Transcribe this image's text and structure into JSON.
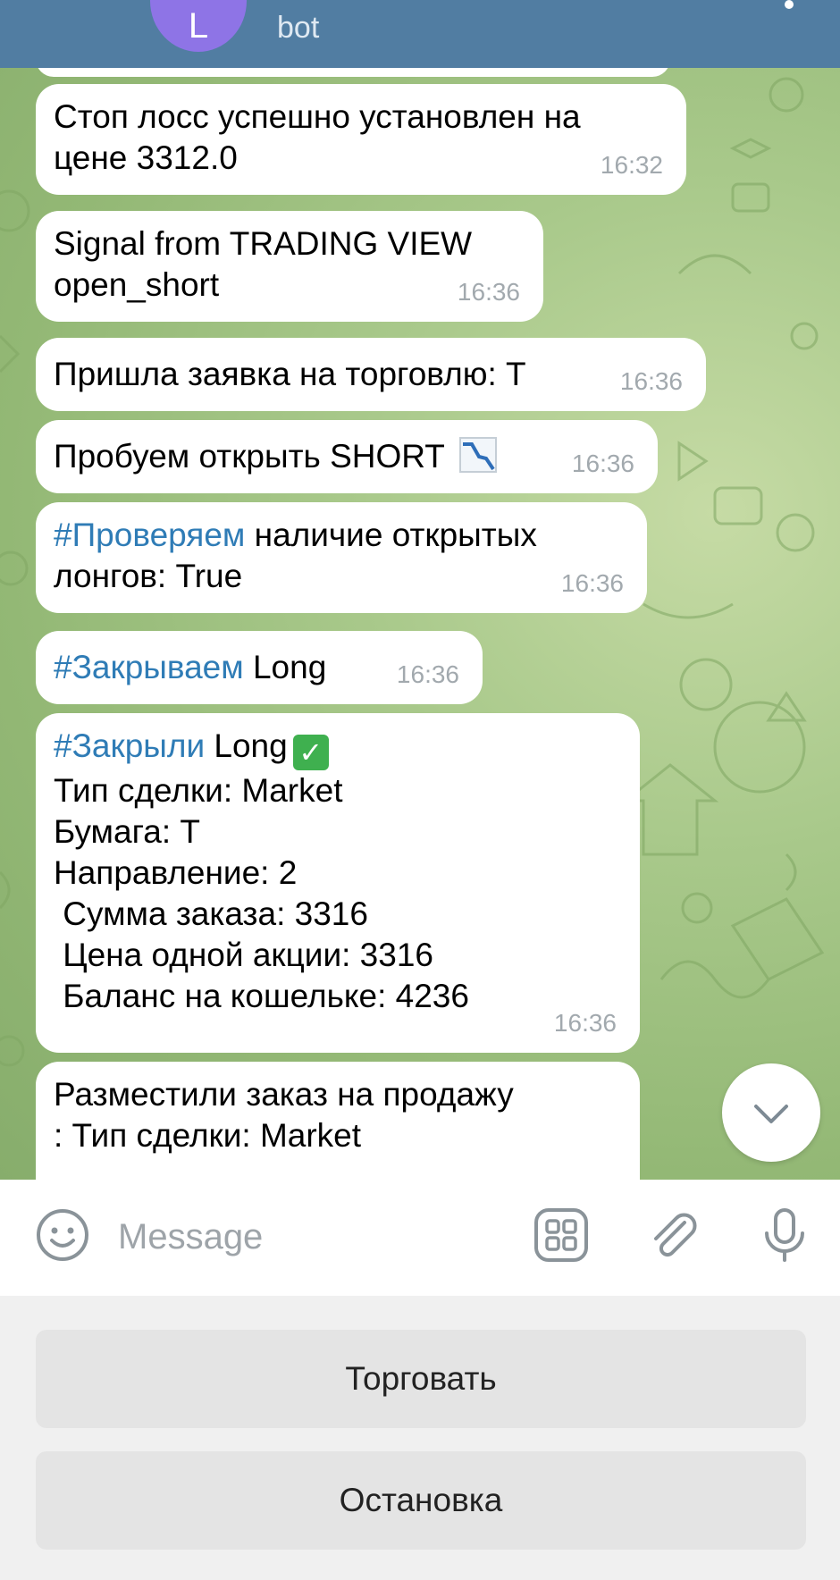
{
  "header": {
    "avatar_letter": "L",
    "subtitle": "bot"
  },
  "messages": [
    {
      "lines": [
        "Стоп лосс успешно установлен на",
        "цене 3312.0"
      ],
      "time": "16:32"
    },
    {
      "lines": [
        "Signal from TRADING VIEW",
        "open_short"
      ],
      "time": "16:36"
    },
    {
      "text": "Пришла заявка на торговлю: T",
      "time": "16:36"
    },
    {
      "text": "Пробуем открыть SHORT",
      "emoji": "chart-decreasing-icon",
      "time": "16:36"
    },
    {
      "hashtag": "#Проверяем",
      "rest": " наличие открытых",
      "line2": "лонгов: True",
      "time": "16:36"
    },
    {
      "hashtag": "#Закрываем",
      "rest": " Long",
      "time": "16:36"
    },
    {
      "hashtag": "#Закрыли",
      "rest": " Long",
      "emoji": "check-mark-icon",
      "lines": [
        "Тип сделки: Market",
        "Бумага: T",
        "Направление: 2",
        " Сумма заказа: 3316",
        " Цена одной акции: 3316",
        " Баланс на кошельке: 4236"
      ],
      "time": "16:36"
    },
    {
      "lines": [
        "Разместили заказ на продажу",
        ": Тип сделки: Market"
      ]
    }
  ],
  "input": {
    "placeholder": "Message"
  },
  "keyboard": {
    "buttons": [
      "Торговать",
      "Остановка"
    ]
  },
  "colors": {
    "header_bg": "#517da2",
    "hashtag": "#2f7cb6",
    "avatar": "#8e74e6",
    "chat_bg": "#a9c98b"
  }
}
